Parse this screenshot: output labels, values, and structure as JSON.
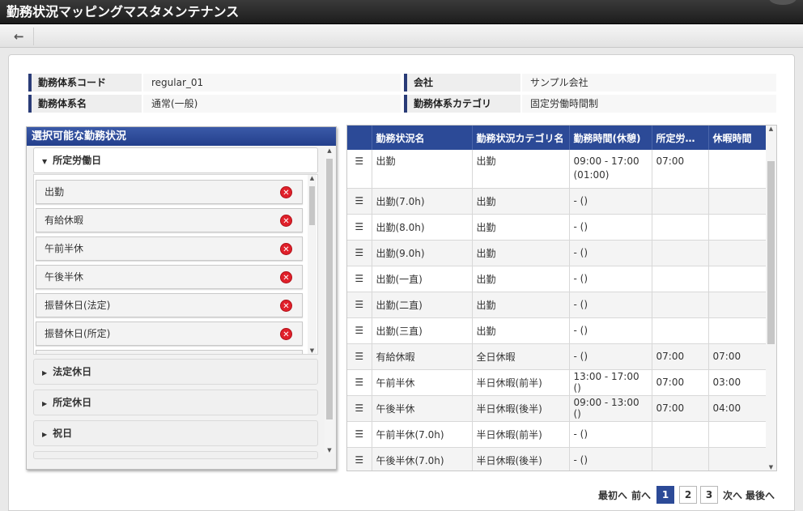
{
  "window": {
    "title": "勤務状況マッピングマスタメンテナンス"
  },
  "toolbar": {
    "back_icon": "←"
  },
  "info": {
    "work_system_code_label": "勤務体系コード",
    "work_system_code": "regular_01",
    "company_label": "会社",
    "company": "サンプル会社",
    "work_system_name_label": "勤務体系名",
    "work_system_name": "通常(一般)",
    "category_label": "勤務体系カテゴリ",
    "category": "固定労働時間制"
  },
  "left_panel": {
    "title": "選択可能な勤務状況",
    "open_section": "所定労働日",
    "items": [
      "出勤",
      "有給休暇",
      "午前半休",
      "午後半休",
      "振替休日(法定)",
      "振替休日(所定)"
    ],
    "remove_icon": "✕",
    "closed_sections": [
      "法定休日",
      "所定休日",
      "祝日"
    ]
  },
  "table": {
    "headers": [
      "勤務状況名",
      "勤務状況カテゴリ名",
      "勤務時間(休憩)",
      "所定労…",
      "休暇時間"
    ],
    "rows": [
      {
        "name": "出勤",
        "category": "出勤",
        "time": "09:00 - 17:00 (01:00)",
        "prescribed": "07:00",
        "leave": ""
      },
      {
        "name": "出勤(7.0h)",
        "category": "出勤",
        "time": "- ()",
        "prescribed": "",
        "leave": ""
      },
      {
        "name": "出勤(8.0h)",
        "category": "出勤",
        "time": "- ()",
        "prescribed": "",
        "leave": ""
      },
      {
        "name": "出勤(9.0h)",
        "category": "出勤",
        "time": "- ()",
        "prescribed": "",
        "leave": ""
      },
      {
        "name": "出勤(一直)",
        "category": "出勤",
        "time": "- ()",
        "prescribed": "",
        "leave": ""
      },
      {
        "name": "出勤(二直)",
        "category": "出勤",
        "time": "- ()",
        "prescribed": "",
        "leave": ""
      },
      {
        "name": "出勤(三直)",
        "category": "出勤",
        "time": "- ()",
        "prescribed": "",
        "leave": ""
      },
      {
        "name": "有給休暇",
        "category": "全日休暇",
        "time": "- ()",
        "prescribed": "07:00",
        "leave": "07:00"
      },
      {
        "name": "午前半休",
        "category": "半日休暇(前半)",
        "time": "13:00 - 17:00 ()",
        "prescribed": "07:00",
        "leave": "03:00"
      },
      {
        "name": "午後半休",
        "category": "半日休暇(後半)",
        "time": "09:00 - 13:00 ()",
        "prescribed": "07:00",
        "leave": "04:00"
      },
      {
        "name": "午前半休(7.0h)",
        "category": "半日休暇(前半)",
        "time": "- ()",
        "prescribed": "",
        "leave": ""
      },
      {
        "name": "午後半休(7.0h)",
        "category": "半日休暇(後半)",
        "time": "- ()",
        "prescribed": "",
        "leave": ""
      }
    ],
    "row_icon": "☰"
  },
  "pager": {
    "first": "最初へ",
    "prev": "前へ",
    "pages": [
      "1",
      "2",
      "3"
    ],
    "current_page": "1",
    "next": "次へ",
    "last": "最後へ"
  }
}
